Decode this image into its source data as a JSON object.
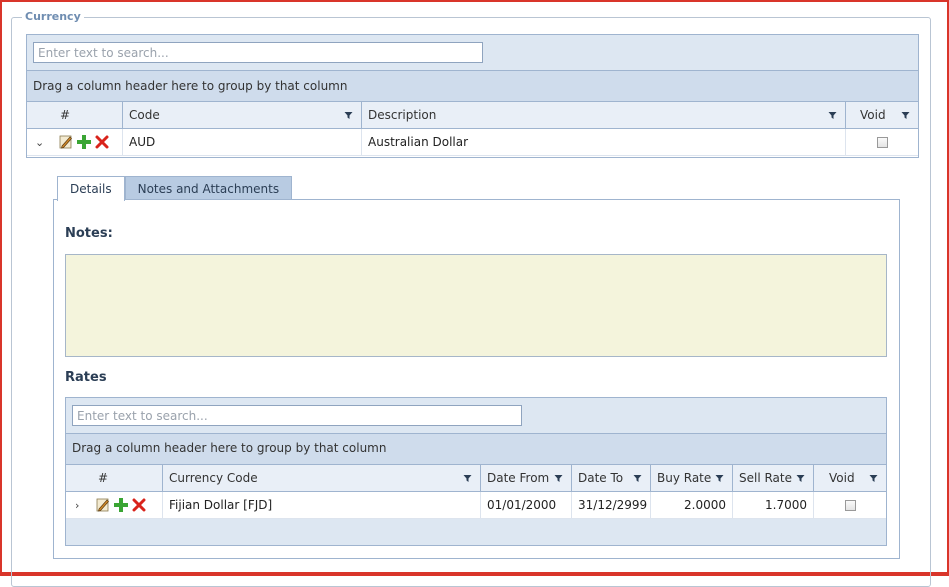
{
  "section_legend": "Currency",
  "outer_grid": {
    "search_placeholder": "Enter text to search...",
    "group_hint": "Drag a column header here to group by that column",
    "columns": [
      "#",
      "Code",
      "Description",
      "Void"
    ],
    "rows": [
      {
        "code": "AUD",
        "description": "Australian Dollar",
        "void": false,
        "expanded": true
      }
    ]
  },
  "detail": {
    "tabs": [
      {
        "label": "Details",
        "active": true
      },
      {
        "label": "Notes and Attachments",
        "active": false
      }
    ],
    "notes_label": "Notes:",
    "rates_label": "Rates",
    "rates_grid": {
      "search_placeholder": "Enter text to search...",
      "group_hint": "Drag a column header here to group by that column",
      "columns": [
        "#",
        "Currency Code",
        "Date From",
        "Date To",
        "Buy Rate",
        "Sell Rate",
        "Void"
      ],
      "rows": [
        {
          "currency_code": "Fijian Dollar [FJD]",
          "date_from": "01/01/2000",
          "date_to": "31/12/2999",
          "buy_rate": "2.0000",
          "sell_rate": "1.7000",
          "void": false
        }
      ]
    }
  },
  "colors": {
    "frame_border": "#d9352a",
    "grid_border": "#9fb4cf",
    "groupbar": "#cfdcec",
    "notes_bg": "#f4f4dc",
    "tab_inactive": "#b8cbe2"
  }
}
